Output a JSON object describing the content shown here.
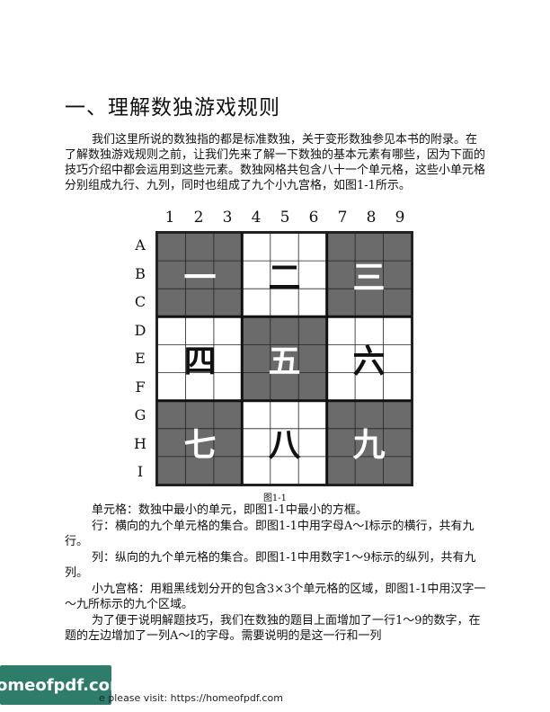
{
  "heading": "一、理解数独游戏规则",
  "intro": "我们这里所说的数独指的都是标准数独，关于变形数独参见本书的附录。在了解数独游戏规则之前，让我们先来了解一下数独的基本元素有哪些，因为下面的技巧介绍中都会运用到这些元素。数独网格共包含八十一个单元格，这些小单元格分别组成九行、九列，同时也组成了九个小九宫格，如图1-1所示。",
  "figure": {
    "columns": [
      "1",
      "2",
      "3",
      "4",
      "5",
      "6",
      "7",
      "8",
      "9"
    ],
    "rows": [
      "A",
      "B",
      "C",
      "D",
      "E",
      "F",
      "G",
      "H",
      "I"
    ],
    "boxes": [
      {
        "label": "一",
        "shade": "dark"
      },
      {
        "label": "二",
        "shade": "light"
      },
      {
        "label": "三",
        "shade": "dark"
      },
      {
        "label": "四",
        "shade": "light"
      },
      {
        "label": "五",
        "shade": "dark"
      },
      {
        "label": "六",
        "shade": "light"
      },
      {
        "label": "七",
        "shade": "dark"
      },
      {
        "label": "八",
        "shade": "light"
      },
      {
        "label": "九",
        "shade": "dark"
      }
    ],
    "caption": "图1-1"
  },
  "definitions": [
    "单元格：数独中最小的单元，即图1-1中最小的方框。",
    "行：横向的九个单元格的集合。即图1-1中用字母A～I标示的横行，共有九行。",
    "列：纵向的九个单元格的集合。即图1-1中用数字1～9标示的纵列，共有九列。",
    "小九宫格：用粗黑线划分开的包含3×3个单元格的区域，即图1-1中用汉字一～九所标示的九个区域。",
    "为了便于说明解题技巧，我们在数独的题目上面增加了一行1～9的数字，在题的左边增加了一列A～I的字母。需要说明的是这一行和一列"
  ],
  "banner": "homeofpdf.com",
  "footer": "e please visit: https://homeofpdf.com"
}
